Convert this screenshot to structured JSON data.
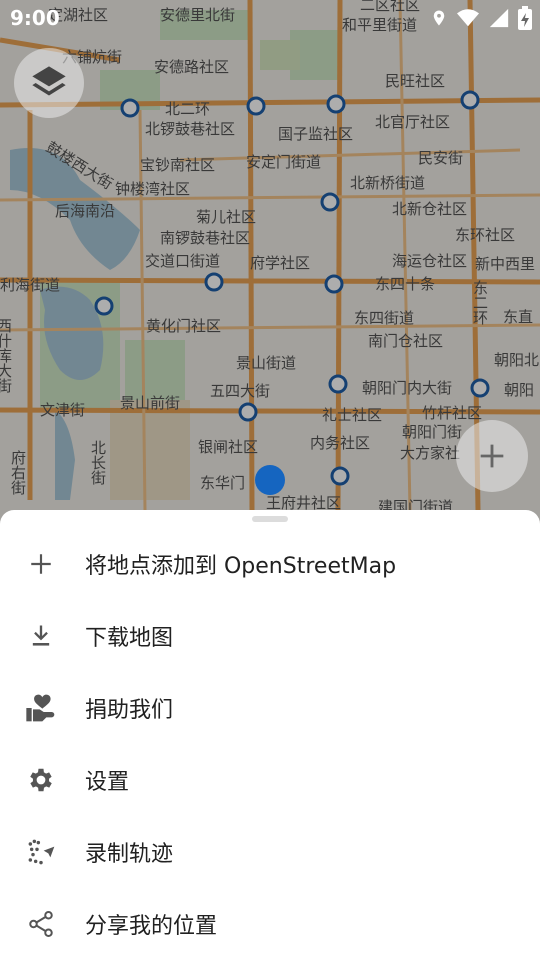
{
  "status_bar": {
    "time": "9:00"
  },
  "map_labels": {
    "l1": "定湖社区",
    "l2": "安德里北街",
    "l3": "和平里街道",
    "l4": "二区社区",
    "l5": "六铺炕街",
    "l6": "安德路社区",
    "l7": "民旺社区",
    "l8": "北二环",
    "l9": "北锣鼓巷社区",
    "l10": "国子监社区",
    "l11": "北官厅社区",
    "l12": "鼓楼西大街",
    "l13": "宝钞南社区",
    "l14": "安定门街道",
    "l15": "民安街",
    "l16": "钟楼湾社区",
    "l17": "北新桥街道",
    "l18": "后海南沿",
    "l19": "菊儿社区",
    "l20": "北新仓社区",
    "l21": "南锣鼓巷社区",
    "l22": "东环社区",
    "l23": "交道口街道",
    "l24": "府学社区",
    "l25": "海运仓社区",
    "l26": "新中西里",
    "l27": "东四十条",
    "l28": "东二环",
    "l29": "黄化门社区",
    "l30": "东四街道",
    "l31": "南门仓社区",
    "l32": "东直",
    "l33": "景山街道",
    "l34": "朝阳门内大街",
    "l35": "朝阳北",
    "l36": "五四大街",
    "l37": "景山前街",
    "l38": "文津街",
    "l39": "礼士社区",
    "l40": "竹杆社区",
    "l41": "北长街",
    "l42": "内务社区",
    "l43": "朝阳门街",
    "l44": "银闸社区",
    "l45": "大方家社",
    "l46": "东华门",
    "l47": "王府井社区",
    "l48": "建国门街道",
    "l49": "利海街道",
    "l50": "西什库大街",
    "l51": "府右街",
    "l52": "朝阳"
  },
  "menu": {
    "items": [
      {
        "label": "将地点添加到 OpenStreetMap",
        "icon": "plus-icon"
      },
      {
        "label": "下载地图",
        "icon": "download-icon"
      },
      {
        "label": "捐助我们",
        "icon": "donate-heart-hand-icon"
      },
      {
        "label": "设置",
        "icon": "gear-icon"
      },
      {
        "label": "录制轨迹",
        "icon": "record-track-icon"
      },
      {
        "label": "分享我的位置",
        "icon": "share-icon"
      }
    ]
  }
}
